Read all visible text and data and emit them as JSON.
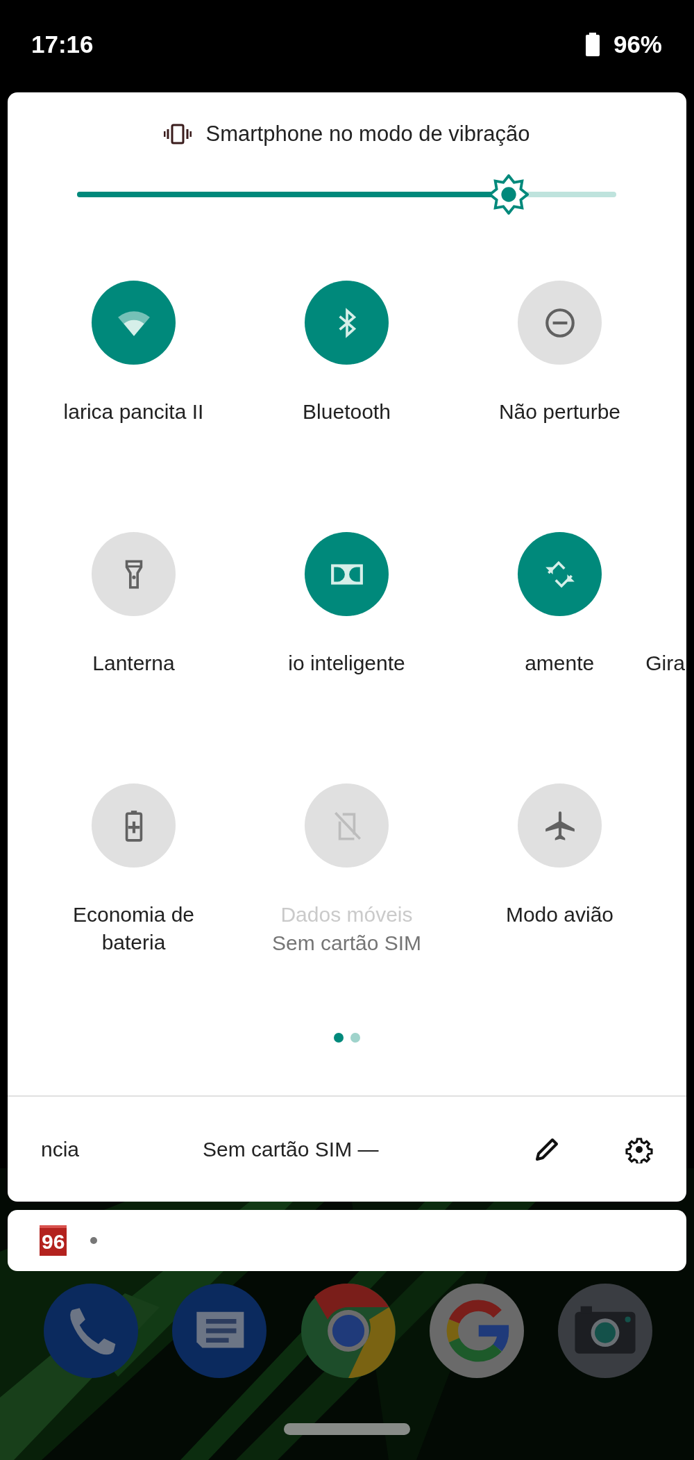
{
  "status_bar": {
    "time": "17:16",
    "battery": "96%"
  },
  "quick_settings": {
    "ringer_status": "Smartphone no modo de vibração",
    "brightness": {
      "level": 0.8
    },
    "tiles": [
      {
        "kind": "wifi",
        "label": "larica pancita II",
        "on": true,
        "disabled": false
      },
      {
        "kind": "bluetooth",
        "label": "Bluetooth",
        "on": true,
        "disabled": false
      },
      {
        "kind": "dnd",
        "label": "Não perturbe",
        "on": false,
        "disabled": false
      },
      {
        "kind": "flashlight",
        "label": "Lanterna",
        "on": false,
        "disabled": false
      },
      {
        "kind": "dolby",
        "label": "io inteligente",
        "on": true,
        "disabled": false
      },
      {
        "kind": "rotate",
        "label": "amente",
        "label_next": "Gira",
        "on": true,
        "disabled": false
      },
      {
        "kind": "battery_saver",
        "label": "Economia de bateria",
        "on": false,
        "disabled": false
      },
      {
        "kind": "mobile_data",
        "label": "Dados móveis",
        "secondary": "Sem cartão SIM",
        "on": false,
        "disabled": true
      },
      {
        "kind": "airplane",
        "label": "Modo avião",
        "on": false,
        "disabled": false
      }
    ],
    "pages": [
      {
        "selected": true
      },
      {
        "selected": false
      }
    ],
    "footer": {
      "left_text": "ncia",
      "carrier": "Sem cartão SIM —"
    }
  },
  "notification": {
    "app_badge": "96"
  },
  "dock": [
    {
      "kind": "phone"
    },
    {
      "kind": "messages"
    },
    {
      "kind": "browser"
    },
    {
      "kind": "google"
    },
    {
      "kind": "camera"
    }
  ]
}
